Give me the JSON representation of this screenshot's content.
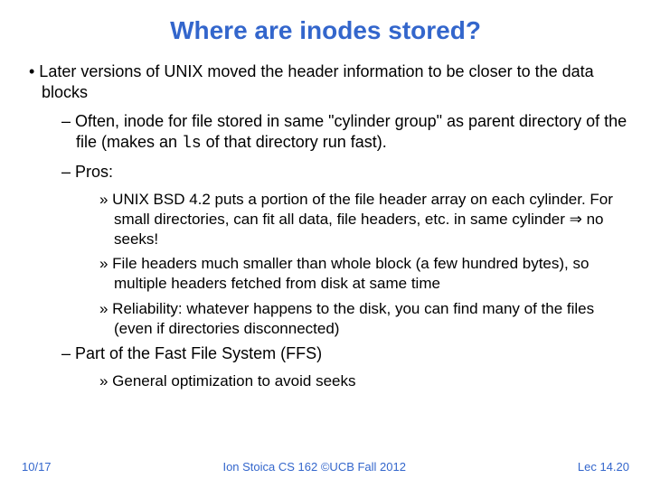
{
  "title": "Where are inodes stored?",
  "bullet1": "• Later versions of UNIX moved the header information to be closer to the data blocks",
  "sub1_pre": "– Often, inode for file stored in same \"cylinder group\" as parent directory of the file (makes an ",
  "sub1_code": "ls",
  "sub1_post": " of that directory run fast).",
  "sub2": "– Pros:",
  "pro1": "» UNIX BSD 4.2 puts a portion of the file header array on each cylinder.  For small directories, can fit all data, file headers, etc. in same cylinder ⇒ no seeks!",
  "pro2": "» File headers much smaller than whole block (a few hundred bytes), so multiple headers fetched from disk at same time",
  "pro3": "» Reliability: whatever happens to the disk, you can find many of the files (even if directories disconnected)",
  "sub3": "– Part of the Fast File System (FFS)",
  "ffs1": "» General optimization to avoid seeks",
  "footer": {
    "left": "10/17",
    "center": "Ion Stoica CS 162 ©UCB Fall 2012",
    "right": "Lec 14.20"
  }
}
